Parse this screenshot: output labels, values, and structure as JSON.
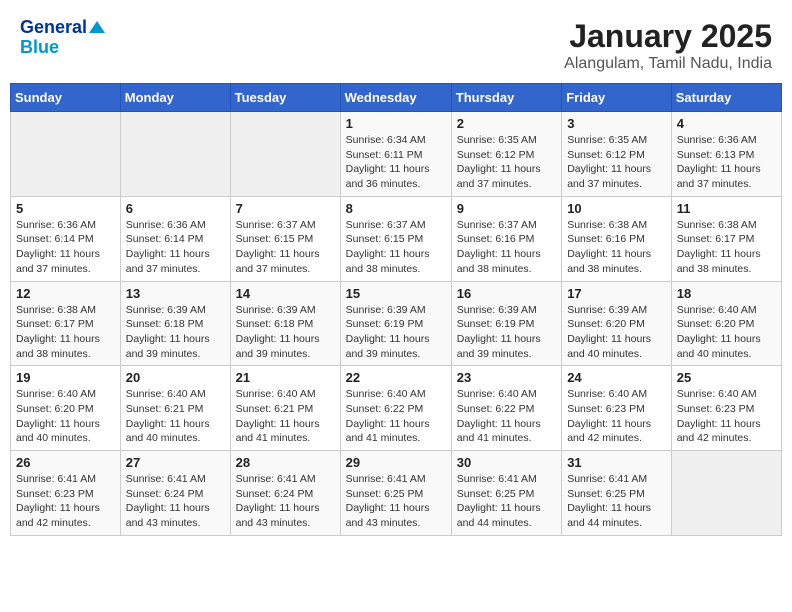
{
  "header": {
    "logo_line1": "General",
    "logo_line2": "Blue",
    "title": "January 2025",
    "subtitle": "Alangulam, Tamil Nadu, India"
  },
  "calendar": {
    "weekdays": [
      "Sunday",
      "Monday",
      "Tuesday",
      "Wednesday",
      "Thursday",
      "Friday",
      "Saturday"
    ],
    "weeks": [
      [
        {
          "day": "",
          "info": ""
        },
        {
          "day": "",
          "info": ""
        },
        {
          "day": "",
          "info": ""
        },
        {
          "day": "1",
          "info": "Sunrise: 6:34 AM\nSunset: 6:11 PM\nDaylight: 11 hours and 36 minutes."
        },
        {
          "day": "2",
          "info": "Sunrise: 6:35 AM\nSunset: 6:12 PM\nDaylight: 11 hours and 37 minutes."
        },
        {
          "day": "3",
          "info": "Sunrise: 6:35 AM\nSunset: 6:12 PM\nDaylight: 11 hours and 37 minutes."
        },
        {
          "day": "4",
          "info": "Sunrise: 6:36 AM\nSunset: 6:13 PM\nDaylight: 11 hours and 37 minutes."
        }
      ],
      [
        {
          "day": "5",
          "info": "Sunrise: 6:36 AM\nSunset: 6:14 PM\nDaylight: 11 hours and 37 minutes."
        },
        {
          "day": "6",
          "info": "Sunrise: 6:36 AM\nSunset: 6:14 PM\nDaylight: 11 hours and 37 minutes."
        },
        {
          "day": "7",
          "info": "Sunrise: 6:37 AM\nSunset: 6:15 PM\nDaylight: 11 hours and 37 minutes."
        },
        {
          "day": "8",
          "info": "Sunrise: 6:37 AM\nSunset: 6:15 PM\nDaylight: 11 hours and 38 minutes."
        },
        {
          "day": "9",
          "info": "Sunrise: 6:37 AM\nSunset: 6:16 PM\nDaylight: 11 hours and 38 minutes."
        },
        {
          "day": "10",
          "info": "Sunrise: 6:38 AM\nSunset: 6:16 PM\nDaylight: 11 hours and 38 minutes."
        },
        {
          "day": "11",
          "info": "Sunrise: 6:38 AM\nSunset: 6:17 PM\nDaylight: 11 hours and 38 minutes."
        }
      ],
      [
        {
          "day": "12",
          "info": "Sunrise: 6:38 AM\nSunset: 6:17 PM\nDaylight: 11 hours and 38 minutes."
        },
        {
          "day": "13",
          "info": "Sunrise: 6:39 AM\nSunset: 6:18 PM\nDaylight: 11 hours and 39 minutes."
        },
        {
          "day": "14",
          "info": "Sunrise: 6:39 AM\nSunset: 6:18 PM\nDaylight: 11 hours and 39 minutes."
        },
        {
          "day": "15",
          "info": "Sunrise: 6:39 AM\nSunset: 6:19 PM\nDaylight: 11 hours and 39 minutes."
        },
        {
          "day": "16",
          "info": "Sunrise: 6:39 AM\nSunset: 6:19 PM\nDaylight: 11 hours and 39 minutes."
        },
        {
          "day": "17",
          "info": "Sunrise: 6:39 AM\nSunset: 6:20 PM\nDaylight: 11 hours and 40 minutes."
        },
        {
          "day": "18",
          "info": "Sunrise: 6:40 AM\nSunset: 6:20 PM\nDaylight: 11 hours and 40 minutes."
        }
      ],
      [
        {
          "day": "19",
          "info": "Sunrise: 6:40 AM\nSunset: 6:20 PM\nDaylight: 11 hours and 40 minutes."
        },
        {
          "day": "20",
          "info": "Sunrise: 6:40 AM\nSunset: 6:21 PM\nDaylight: 11 hours and 40 minutes."
        },
        {
          "day": "21",
          "info": "Sunrise: 6:40 AM\nSunset: 6:21 PM\nDaylight: 11 hours and 41 minutes."
        },
        {
          "day": "22",
          "info": "Sunrise: 6:40 AM\nSunset: 6:22 PM\nDaylight: 11 hours and 41 minutes."
        },
        {
          "day": "23",
          "info": "Sunrise: 6:40 AM\nSunset: 6:22 PM\nDaylight: 11 hours and 41 minutes."
        },
        {
          "day": "24",
          "info": "Sunrise: 6:40 AM\nSunset: 6:23 PM\nDaylight: 11 hours and 42 minutes."
        },
        {
          "day": "25",
          "info": "Sunrise: 6:40 AM\nSunset: 6:23 PM\nDaylight: 11 hours and 42 minutes."
        }
      ],
      [
        {
          "day": "26",
          "info": "Sunrise: 6:41 AM\nSunset: 6:23 PM\nDaylight: 11 hours and 42 minutes."
        },
        {
          "day": "27",
          "info": "Sunrise: 6:41 AM\nSunset: 6:24 PM\nDaylight: 11 hours and 43 minutes."
        },
        {
          "day": "28",
          "info": "Sunrise: 6:41 AM\nSunset: 6:24 PM\nDaylight: 11 hours and 43 minutes."
        },
        {
          "day": "29",
          "info": "Sunrise: 6:41 AM\nSunset: 6:25 PM\nDaylight: 11 hours and 43 minutes."
        },
        {
          "day": "30",
          "info": "Sunrise: 6:41 AM\nSunset: 6:25 PM\nDaylight: 11 hours and 44 minutes."
        },
        {
          "day": "31",
          "info": "Sunrise: 6:41 AM\nSunset: 6:25 PM\nDaylight: 11 hours and 44 minutes."
        },
        {
          "day": "",
          "info": ""
        }
      ]
    ]
  }
}
